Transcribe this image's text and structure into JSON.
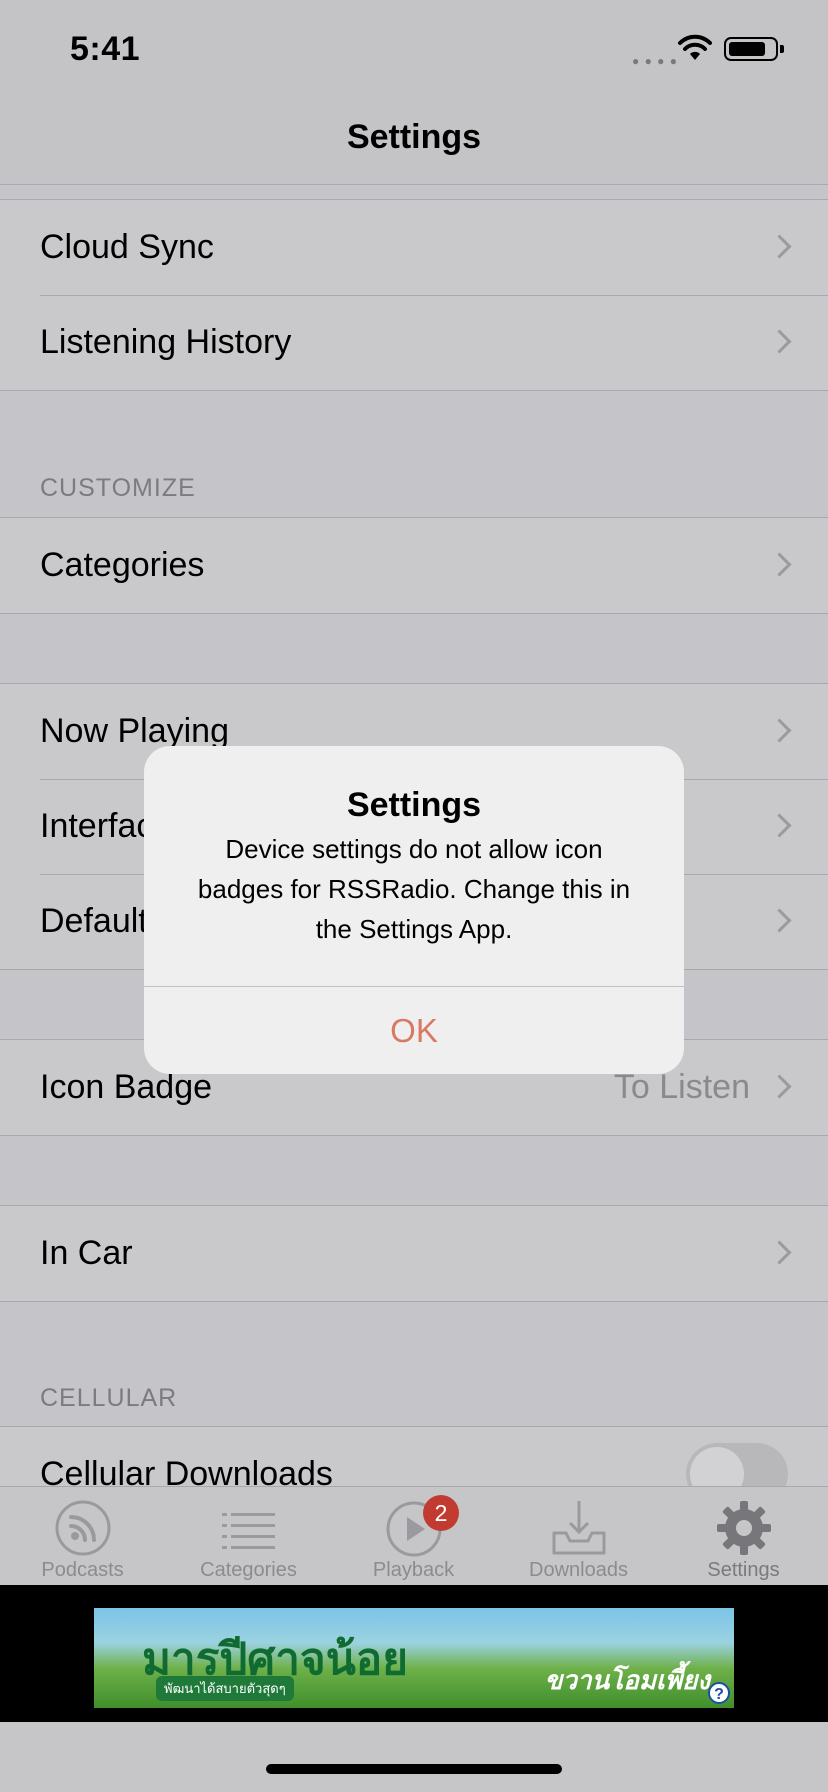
{
  "status_bar": {
    "time": "5:41",
    "signal_icon": "cellular-dots-icon",
    "wifi_icon": "wifi-icon",
    "battery_icon": "battery-icon"
  },
  "nav": {
    "title": "Settings"
  },
  "rows_top": [
    {
      "label": "Cloud Sync",
      "icon": "chevron-right-icon"
    },
    {
      "label": "Listening History",
      "icon": "chevron-right-icon"
    }
  ],
  "customize": {
    "header": "CUSTOMIZE",
    "rows": [
      {
        "label": "Categories",
        "icon": "chevron-right-icon"
      }
    ]
  },
  "rows_mid": [
    {
      "label": "Now Playing"
    },
    {
      "label": "Interface"
    },
    {
      "label": "Default"
    }
  ],
  "icon_badge_row": {
    "label": "Icon Badge",
    "value": "To Listen"
  },
  "in_car_row": {
    "label": "In Car"
  },
  "cellular": {
    "header": "CELLULAR",
    "rows": [
      {
        "label": "Cellular Downloads",
        "toggle_on": false
      }
    ]
  },
  "tab_bar": {
    "tabs": [
      {
        "label": "Podcasts",
        "icon": "podcast-icon"
      },
      {
        "label": "Categories",
        "icon": "list-icon"
      },
      {
        "label": "Playback",
        "icon": "play-icon",
        "badge": "2"
      },
      {
        "label": "Downloads",
        "icon": "download-tray-icon"
      },
      {
        "label": "Settings",
        "icon": "gear-icon",
        "active": true
      }
    ]
  },
  "ad": {
    "title": "มารปีศาจน้อย",
    "subtitle": "พัฒนาได้สบายตัวสุดๆ",
    "right_text": "ขวานโอมเพี้ยง",
    "help": "?"
  },
  "alert": {
    "title": "Settings",
    "message": "Device settings do not allow icon badges for RSSRadio. Change this in the Settings App.",
    "button": "OK",
    "button_color": "#d97965"
  }
}
